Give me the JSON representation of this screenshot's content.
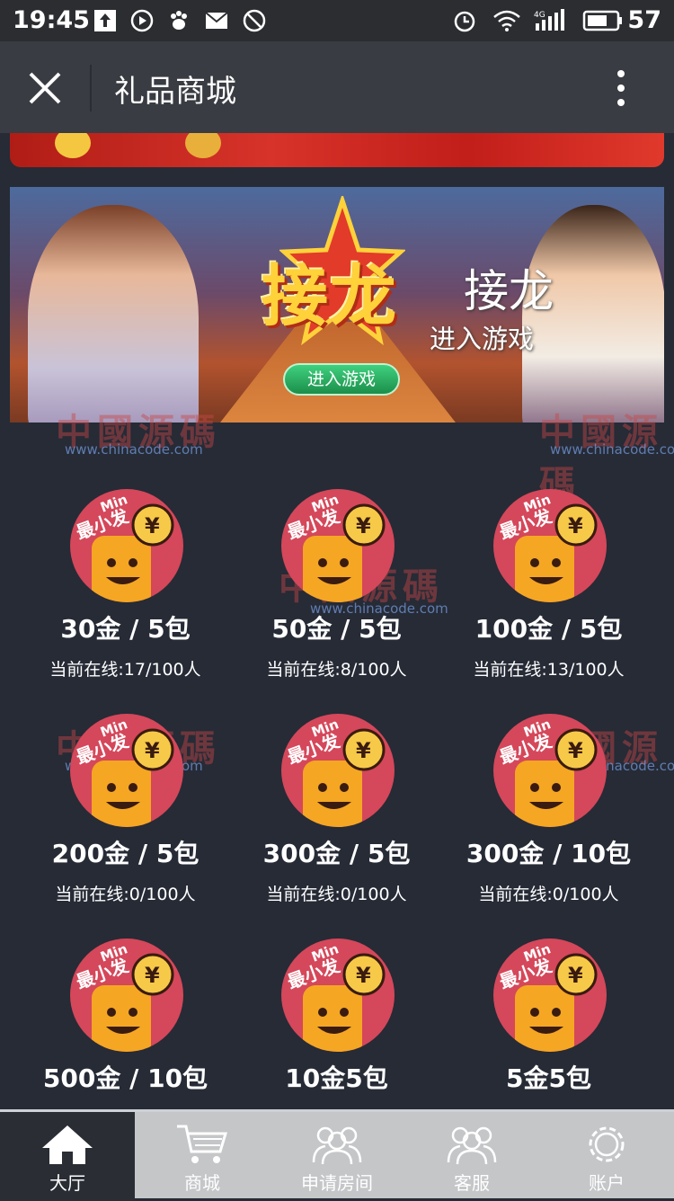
{
  "status_bar": {
    "time": "19:45",
    "network": "4G",
    "battery": "57"
  },
  "titlebar": {
    "title": "礼品商城"
  },
  "banner": {
    "logo_text": "接龙",
    "enter_button": "进入游戏",
    "title": "接龙",
    "subtitle": "进入游戏"
  },
  "watermark": {
    "text": "中國源碼",
    "url": "www.chinacode.com"
  },
  "rooms": [
    {
      "name": "30金 / 5包",
      "online": "当前在线:17/100人",
      "badge_top": "Min",
      "badge_text": "最小发",
      "badge_symbol": "¥"
    },
    {
      "name": "50金 / 5包",
      "online": "当前在线:8/100人",
      "badge_top": "Min",
      "badge_text": "最小发",
      "badge_symbol": "¥"
    },
    {
      "name": "100金 / 5包",
      "online": "当前在线:13/100人",
      "badge_top": "Min",
      "badge_text": "最小发",
      "badge_symbol": "¥"
    },
    {
      "name": "200金 / 5包",
      "online": "当前在线:0/100人",
      "badge_top": "Min",
      "badge_text": "最小发",
      "badge_symbol": "¥"
    },
    {
      "name": "300金 / 5包",
      "online": "当前在线:0/100人",
      "badge_top": "Min",
      "badge_text": "最小发",
      "badge_symbol": "¥"
    },
    {
      "name": "300金 / 10包",
      "online": "当前在线:0/100人",
      "badge_top": "Min",
      "badge_text": "最小发",
      "badge_symbol": "¥"
    },
    {
      "name": "500金 / 10包",
      "online": "",
      "badge_top": "Min",
      "badge_text": "最小发",
      "badge_symbol": "¥"
    },
    {
      "name": "10金5包",
      "online": "",
      "badge_top": "Min",
      "badge_text": "最小发",
      "badge_symbol": "¥"
    },
    {
      "name": "5金5包",
      "online": "",
      "badge_top": "Min",
      "badge_text": "最小发",
      "badge_symbol": "¥"
    }
  ],
  "tabbar": {
    "active_color": "#2a2d34",
    "items": [
      {
        "label": "大厅",
        "icon": "home-icon"
      },
      {
        "label": "商城",
        "icon": "cart-icon"
      },
      {
        "label": "申请房间",
        "icon": "group-icon"
      },
      {
        "label": "客服",
        "icon": "support-icon"
      },
      {
        "label": "账户",
        "icon": "gear-icon"
      }
    ]
  },
  "colors": {
    "background": "#262b36",
    "titlebar": "#393c42",
    "badge": "#d5475a",
    "tabbar": "#c4c6c8"
  }
}
